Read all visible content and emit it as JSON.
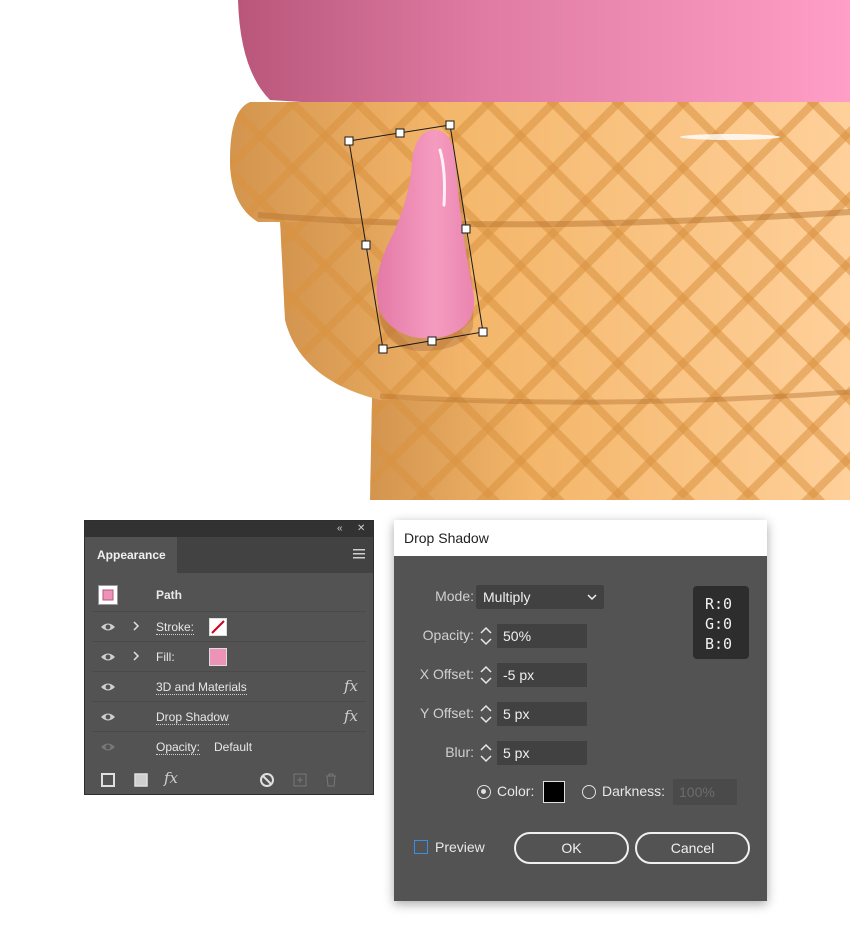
{
  "appearance": {
    "tab_label": "Appearance",
    "collapse_glyph": "«",
    "close_glyph": "✕",
    "rows": [
      {
        "label": "Path"
      },
      {
        "label": "Stroke:"
      },
      {
        "label": "Fill:"
      },
      {
        "label": "3D and Materials",
        "fx": "fx"
      },
      {
        "label": "Drop Shadow",
        "fx": "fx"
      },
      {
        "label": "Opacity:",
        "value": "Default"
      }
    ],
    "fill_color": "#ee93b8",
    "bottom_fx": "fx"
  },
  "dialog": {
    "title": "Drop Shadow",
    "mode_label": "Mode:",
    "mode_value": "Multiply",
    "opacity_label": "Opacity:",
    "opacity_value": "50%",
    "xoffset_label": "X Offset:",
    "xoffset_value": "-5 px",
    "yoffset_label": "Y Offset:",
    "yoffset_value": "5 px",
    "blur_label": "Blur:",
    "blur_value": "5 px",
    "rgb_r": "R:0",
    "rgb_g": "G:0",
    "rgb_b": "B:0",
    "color_label": "Color:",
    "color_value": "#000000",
    "darkness_label": "Darkness:",
    "darkness_value": "100%",
    "preview_label": "Preview",
    "ok_label": "OK",
    "cancel_label": "Cancel"
  }
}
